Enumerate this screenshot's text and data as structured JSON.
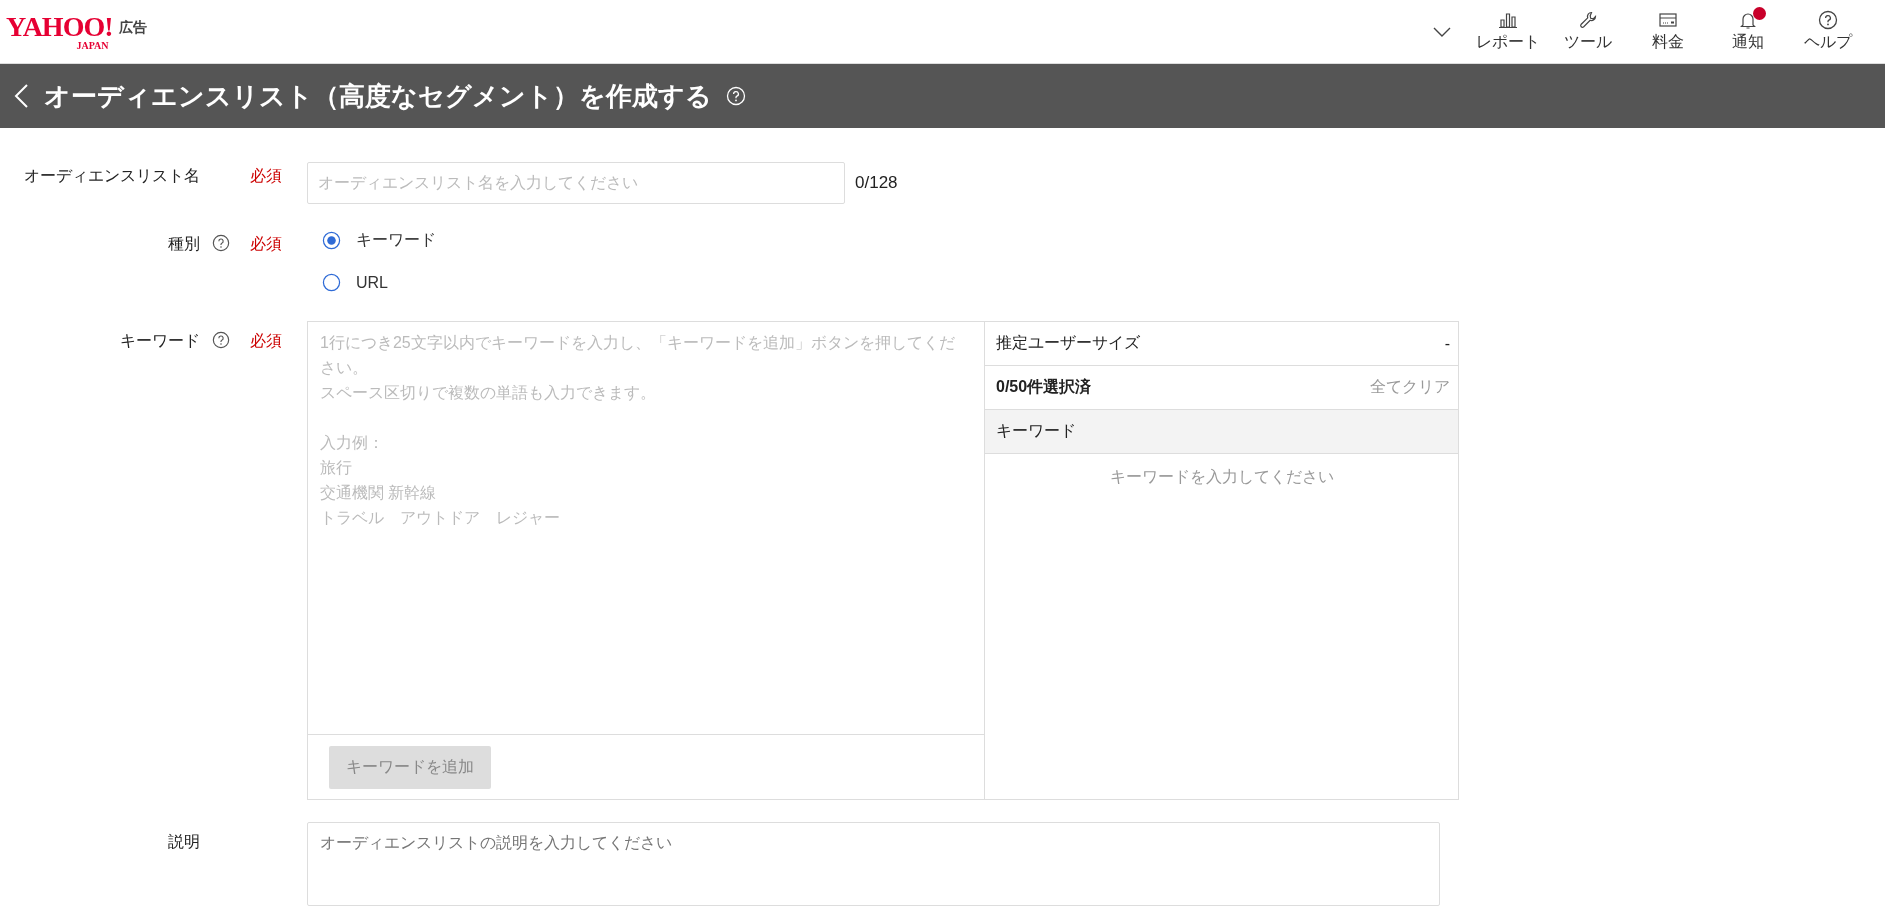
{
  "header": {
    "logo": {
      "brand": "YAHOO!",
      "sub": "JAPAN",
      "service": "広告"
    },
    "nav": [
      {
        "label": "レポート",
        "badge": false
      },
      {
        "label": "ツール",
        "badge": false
      },
      {
        "label": "料金",
        "badge": false
      },
      {
        "label": "通知",
        "badge": true
      },
      {
        "label": "ヘルプ",
        "badge": false
      }
    ]
  },
  "page_title": {
    "text": "オーディエンスリスト（高度なセグメント）を作成する",
    "help": true
  },
  "fields": [
    {
      "kind": "text",
      "label": "オーディエンスリスト名",
      "help": false,
      "required": true,
      "required_label": "必須",
      "placeholder": "オーディエンスリスト名を入力してください",
      "counter": "0/128"
    },
    {
      "kind": "radio",
      "label": "種別",
      "help": true,
      "required": true,
      "required_label": "必須",
      "options": [
        {
          "label": "キーワード",
          "selected": true
        },
        {
          "label": "URL",
          "selected": false
        }
      ]
    },
    {
      "kind": "keywords",
      "label": "キーワード",
      "help": true,
      "required": true,
      "required_label": "必須",
      "hint_paragraphs": [
        [
          "1行につき25文字以内でキーワードを入力し、「キーワードを追加」ボタンを押してください。",
          "スペース区切りで複数の単語も入力できます。"
        ],
        [
          "入力例：",
          "旅行",
          "交通機関 新幹線",
          "トラベル　アウトドア　レジャー"
        ]
      ],
      "add_button": {
        "label": "キーワードを追加",
        "disabled": true
      },
      "panel": {
        "size_label": "推定ユーザーサイズ",
        "size_value": "-",
        "selected_count": "0/50件選択済",
        "clear_label": "全てクリア",
        "column": "キーワード",
        "empty_text": "キーワードを入力してください"
      }
    },
    {
      "kind": "textarea",
      "label": "説明",
      "help": false,
      "required": false,
      "placeholder": "オーディエンスリストの説明を入力してください"
    }
  ]
}
